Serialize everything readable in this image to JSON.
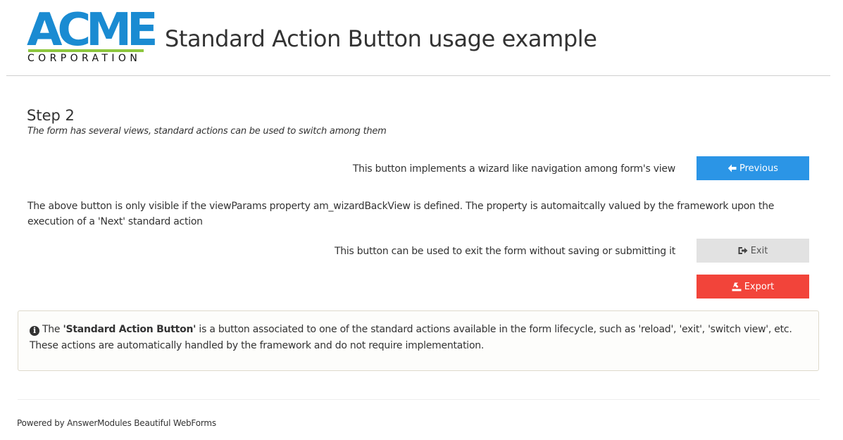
{
  "header": {
    "logo_main": "ACME",
    "logo_sub": "CORPORATION",
    "title": "Standard Action Button usage example"
  },
  "step": {
    "title": "Step 2",
    "subtitle": "The form has several views, standard actions can be used to switch among them"
  },
  "rows": {
    "previous_label": "This button implements a wizard like navigation among form's view",
    "previous_button": "Previous",
    "previous_icon": "arrow-left-icon",
    "paragraph": "The above button is only visible if the viewParams property am_wizardBackView is defined. The property is automaitcally valued by the framework upon the execution of a 'Next' standard action",
    "exit_label": "This button can be used to exit the form without saving or submitting it",
    "exit_button": "Exit",
    "exit_icon": "sign-out-icon",
    "export_button": "Export",
    "export_icon": "export-icon"
  },
  "info": {
    "icon": "info-circle-icon",
    "lead": "The ",
    "highlight": "'Standard Action Button'",
    "body": " is a button associated to one of the standard actions available in the form lifecycle, such as 'reload', 'exit', 'switch view', etc. These actions are automatically handled by the framework and do not require implementation."
  },
  "footer": {
    "text": "Powered by AnswerModules Beautiful WebForms"
  },
  "colors": {
    "logo_blue": "#1a8bd2",
    "logo_green": "#8dc63f",
    "primary_button": "#2b95e6",
    "default_button": "#e2e2e2",
    "danger_button": "#f2443a"
  }
}
